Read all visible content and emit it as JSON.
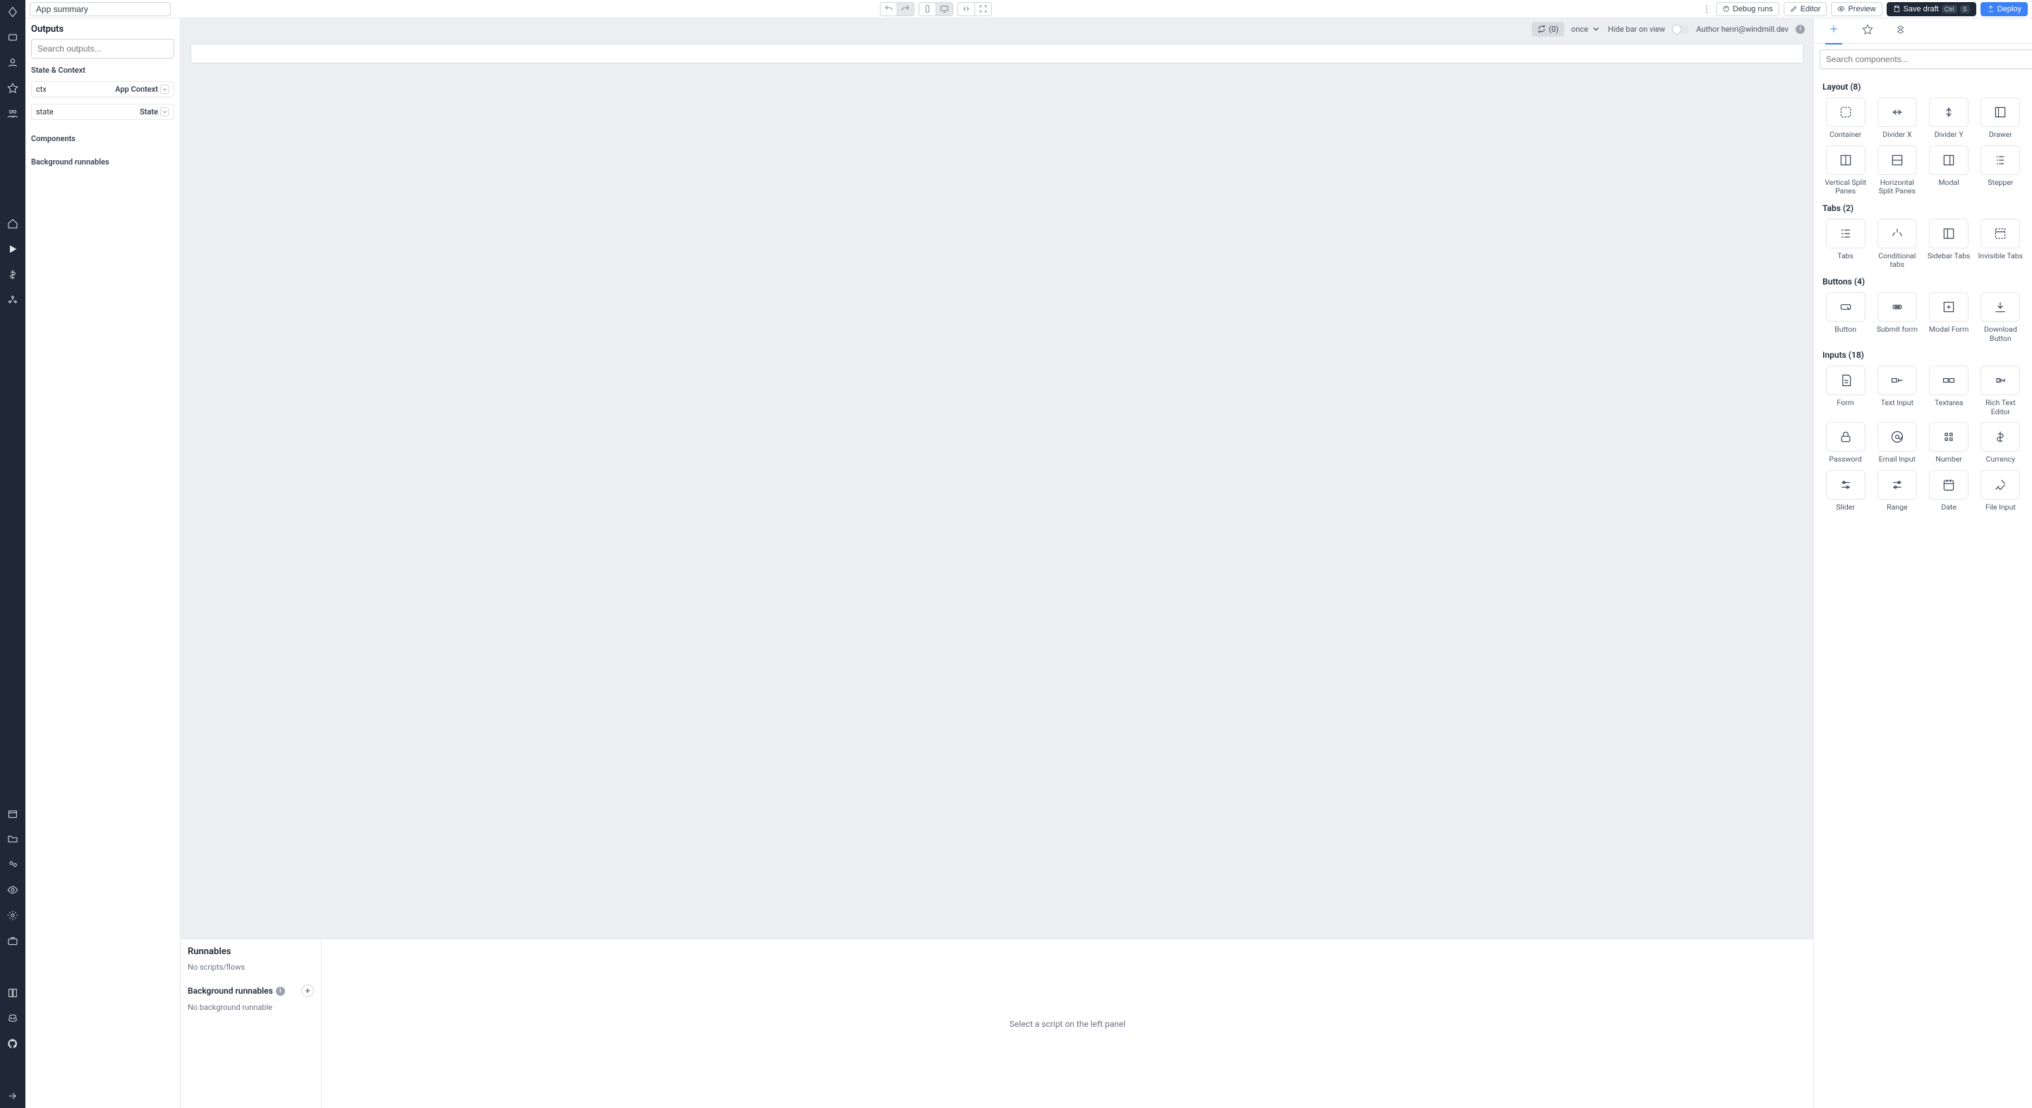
{
  "topbar": {
    "title": "App summary",
    "debug": "Debug runs",
    "editor": "Editor",
    "preview": "Preview",
    "savedraft": "Save draft",
    "savedraft_kbd": "Ctrl",
    "savedraft_kbd2": "S",
    "deploy": "Deploy"
  },
  "outputs": {
    "header": "Outputs",
    "search_ph": "Search outputs...",
    "state_h": "State & Context",
    "ctx": "ctx",
    "ctx_tag": "App Context",
    "state": "state",
    "state_tag": "State",
    "components_h": "Components",
    "bg_h": "Background runnables"
  },
  "canvas": {
    "run_count": "(0)",
    "mode": "once",
    "hide": "Hide bar on view",
    "author_lbl": "Author",
    "author": "henri@windmill.dev"
  },
  "runnables": {
    "header": "Runnables",
    "empty": "No scripts/flows",
    "bg_header": "Background runnables",
    "bg_empty": "No background runnable",
    "placeholder": "Select a script on the left panel"
  },
  "rightpanel": {
    "search_ph": "Search components...",
    "cats": {
      "layout": "Layout (8)",
      "tabs": "Tabs (2)",
      "buttons": "Buttons (4)",
      "inputs": "Inputs (18)"
    },
    "layout": [
      "Container",
      "Divider X",
      "Divider Y",
      "Drawer",
      "Vertical Split Panes",
      "Horizontal Split Panes",
      "Modal",
      "Stepper"
    ],
    "tabs": [
      "Tabs",
      "Conditional tabs",
      "Sidebar Tabs",
      "Invisible Tabs"
    ],
    "buttons": [
      "Button",
      "Submit form",
      "Modal Form",
      "Download Button"
    ],
    "inputs": [
      "Form",
      "Text Input",
      "Textarea",
      "Rich Text Editor",
      "Password",
      "Email Input",
      "Number",
      "Currency",
      "Slider",
      "Range",
      "Date",
      "File Input"
    ]
  }
}
